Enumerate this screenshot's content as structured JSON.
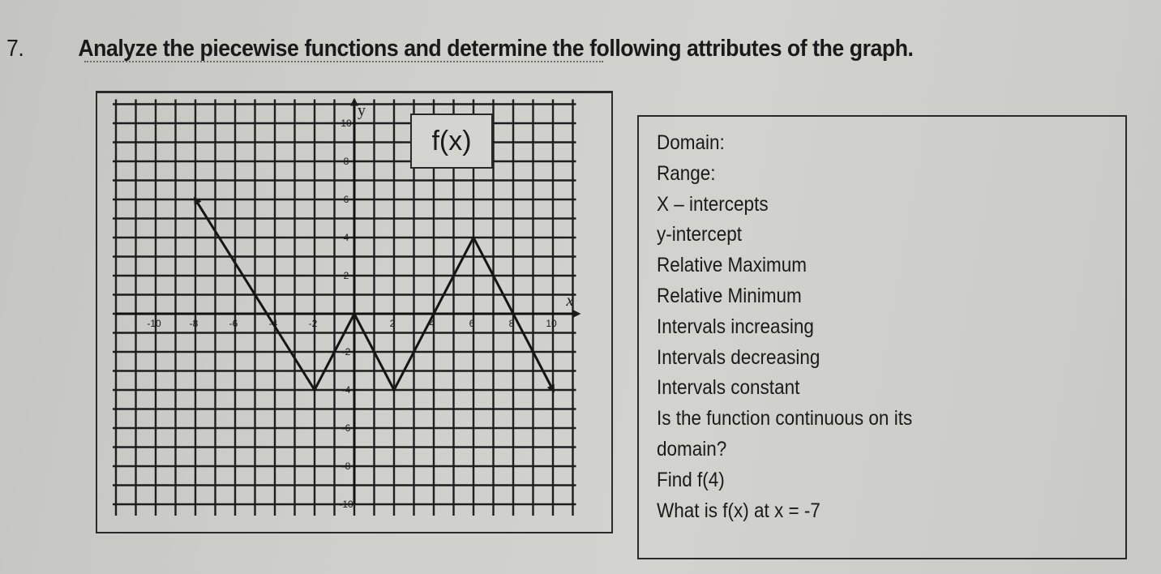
{
  "question": {
    "number": "7.",
    "text": "Analyze the piecewise functions and determine the following attributes of the graph."
  },
  "graph": {
    "function_label": "f(x)",
    "axis_labels": {
      "x": "x",
      "y": "y"
    }
  },
  "answers": {
    "prompts": [
      "Domain:",
      "Range:",
      "X – intercepts",
      "y-intercept",
      "Relative Maximum",
      "Relative Minimum",
      "Intervals increasing",
      "Intervals decreasing",
      "Intervals constant",
      "Is the function continuous on its",
      "domain?",
      "Find f(4)",
      "What is f(x) at x = -7"
    ]
  },
  "chart_data": {
    "type": "line",
    "title": "f(x)",
    "xlabel": "x",
    "ylabel": "y",
    "xlim": [
      -12,
      11
    ],
    "ylim": [
      -10,
      11
    ],
    "grid": true,
    "x_ticks": [
      -10,
      -8,
      -6,
      -4,
      -2,
      2,
      4,
      6,
      8,
      10
    ],
    "x_tick_labels": [
      "-10",
      "-8",
      "-6",
      "-4",
      "-2",
      "2",
      "4",
      "6",
      "8",
      "10"
    ],
    "y_ticks": [
      10,
      8,
      6,
      4,
      2,
      -2,
      -4,
      -6,
      -8,
      -10
    ],
    "y_tick_labels": [
      "10",
      "8",
      "6",
      "4",
      "2",
      "-2",
      "-4",
      "-6",
      "-8",
      "-10"
    ],
    "series": [
      {
        "name": "f(x)",
        "points": [
          [
            -8,
            6
          ],
          [
            -2,
            -4
          ],
          [
            0,
            0
          ],
          [
            2,
            -4
          ],
          [
            6,
            4
          ],
          [
            10,
            -4
          ]
        ],
        "arrow_start": true,
        "arrow_end": true
      }
    ]
  }
}
